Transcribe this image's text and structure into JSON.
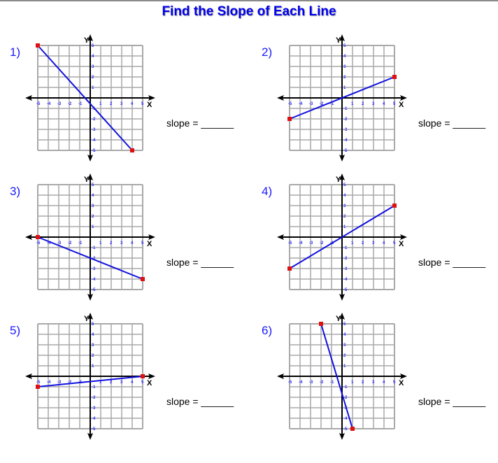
{
  "title": "Find the Slope of Each Line",
  "slope_label": "slope = ______",
  "axis_labels": {
    "x": "X",
    "y": "Y"
  },
  "colors": {
    "title": "#0000ee",
    "line": "#1010e0",
    "point": "#e01010",
    "grid": "#a9a9a9",
    "ticks": "#2a2aff"
  },
  "chart_data": {
    "type": "line",
    "xlim": [
      -5,
      5
    ],
    "ylim": [
      -5,
      5
    ],
    "grid": true,
    "tick_labels": [
      "-5",
      "-4",
      "-3",
      "-2",
      "-1",
      "1",
      "2",
      "3",
      "4",
      "5"
    ],
    "problems": [
      {
        "label": "1)",
        "p1": [
          -5,
          5
        ],
        "p2": [
          4,
          -5
        ]
      },
      {
        "label": "2)",
        "p1": [
          -5,
          -2
        ],
        "p2": [
          5,
          2
        ]
      },
      {
        "label": "3)",
        "p1": [
          -5,
          0
        ],
        "p2": [
          5,
          -4
        ]
      },
      {
        "label": "4)",
        "p1": [
          -5,
          -3
        ],
        "p2": [
          5,
          3
        ]
      },
      {
        "label": "5)",
        "p1": [
          -5,
          -1
        ],
        "p2": [
          5,
          0
        ]
      },
      {
        "label": "6)",
        "p1": [
          -2,
          5
        ],
        "p2": [
          1,
          -5
        ]
      }
    ]
  }
}
